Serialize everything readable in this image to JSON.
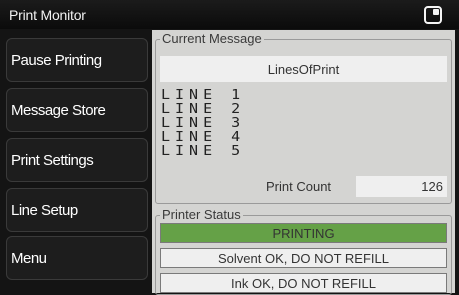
{
  "title": "Print Monitor",
  "title_icon": "window-restore-icon",
  "buttons": [
    "Pause Printing",
    "Message Store",
    "Print Settings",
    "Line Setup",
    "Menu"
  ],
  "current_message": {
    "heading": "Current Message",
    "message_name": "LinesOfPrint",
    "lines": [
      "LINE 1",
      "LINE 2",
      "LINE 3",
      "LINE 4",
      "LINE 5"
    ],
    "print_count_label": "Print Count",
    "print_count_value": "126"
  },
  "printer_status": {
    "heading": "Printer Status",
    "state": "PRINTING",
    "state_color": "#65a147",
    "solvent": "Solvent OK, DO NOT REFILL",
    "ink": "Ink OK, DO NOT REFILL"
  }
}
